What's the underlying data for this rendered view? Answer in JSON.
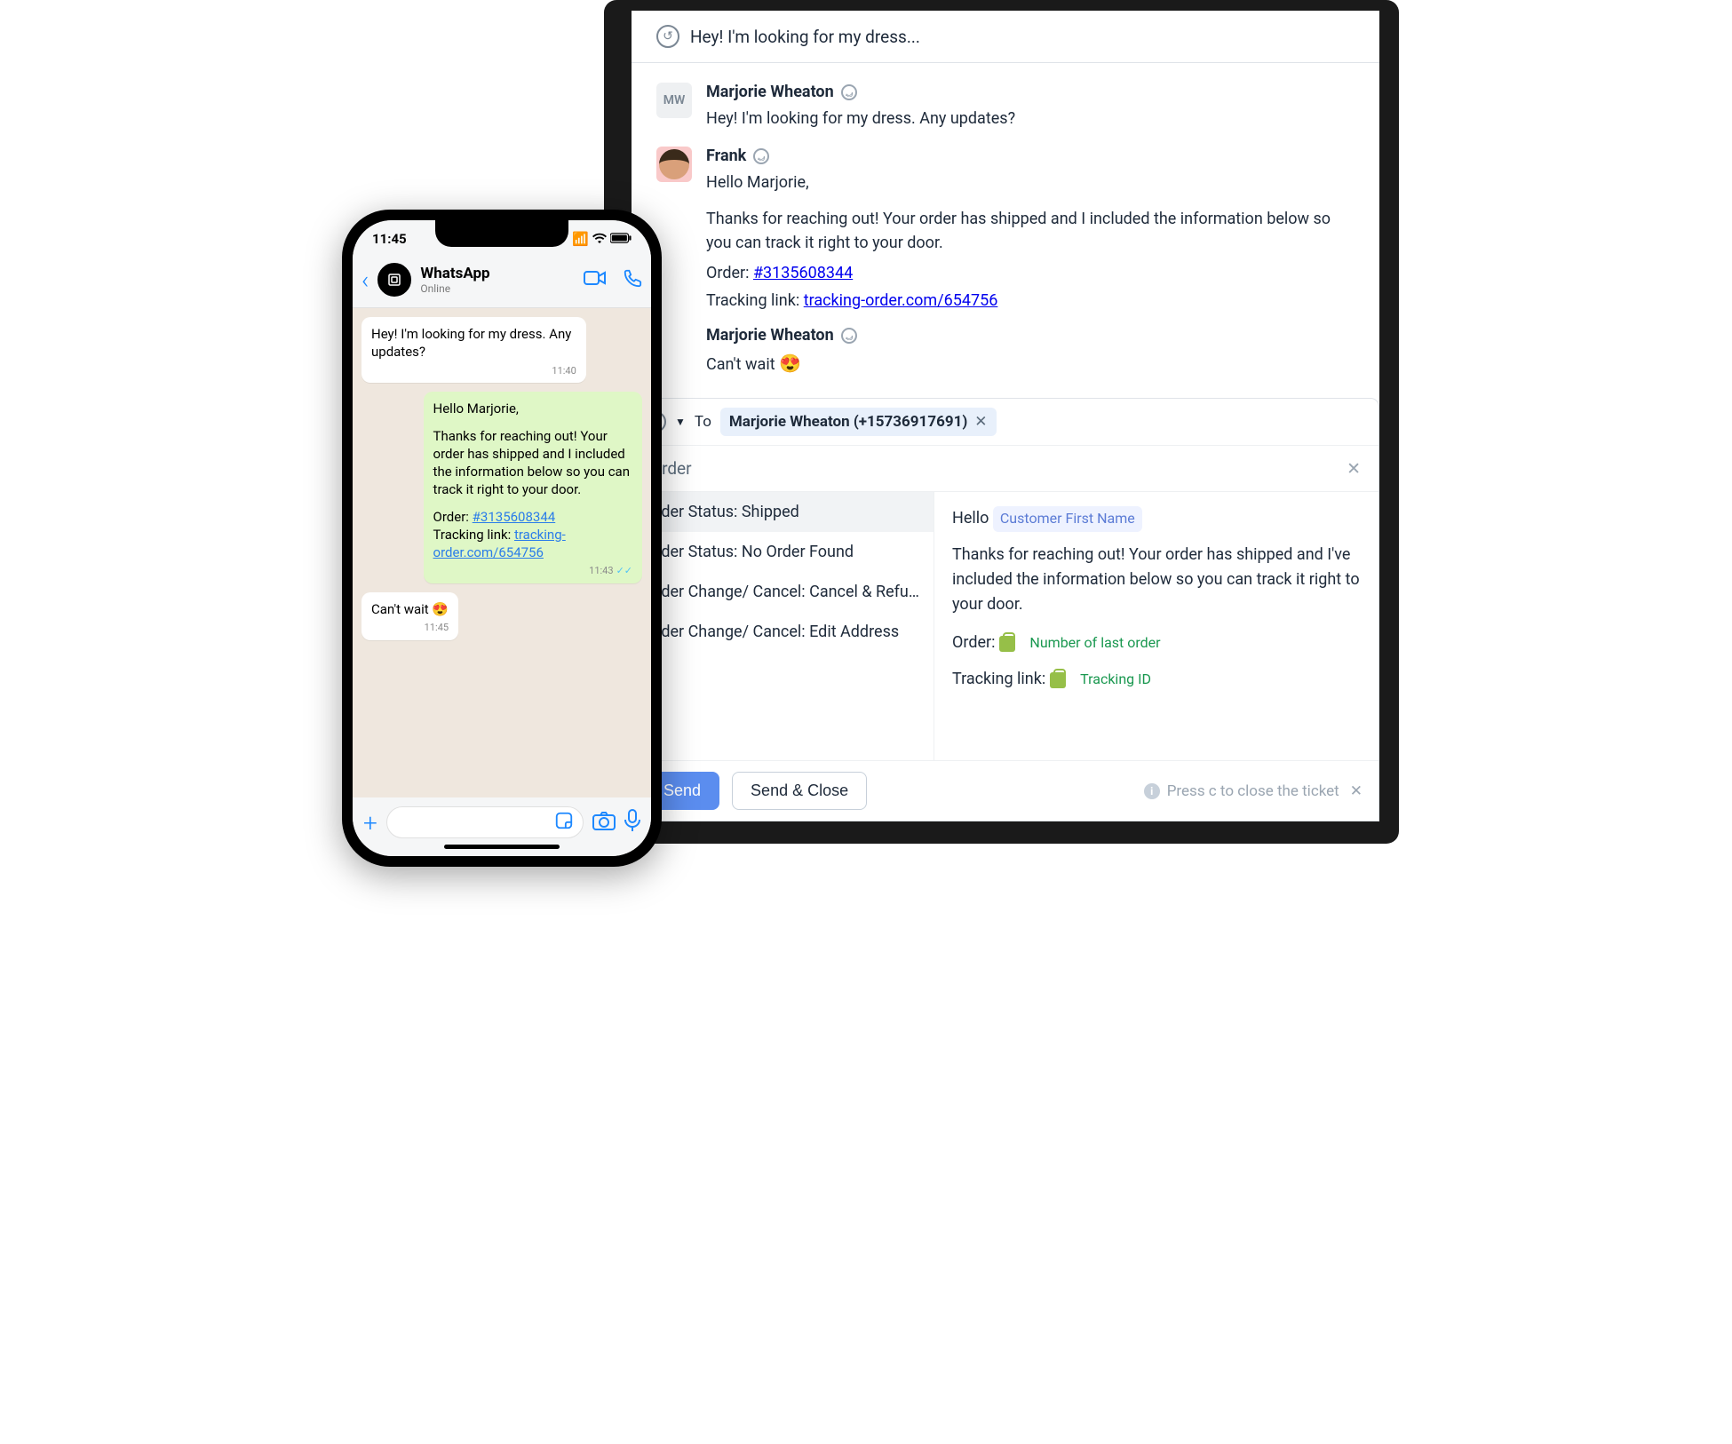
{
  "helpdesk": {
    "subject": "Hey! I'm looking for my dress...",
    "messages": {
      "m1": {
        "author": "Marjorie Wheaton",
        "initials": "MW",
        "text": "Hey! I'm looking for my dress. Any updates?"
      },
      "m2": {
        "author": "Frank",
        "greeting": "Hello Marjorie,",
        "body": "Thanks for reaching out! Your order has shipped and I included the information below so you can track it right to your door.",
        "order_label": "Order:",
        "order_value": "#3135608344",
        "tracking_label": "Tracking link:",
        "tracking_value": "tracking-order.com/654756"
      },
      "m3": {
        "author": "Marjorie Wheaton",
        "text": "Can't wait",
        "emoji": "😍"
      }
    },
    "compose": {
      "to_label": "To",
      "recipient_name": "Marjorie Wheaton (+15736917691)",
      "search_placeholder": "Order",
      "macros": [
        "Order Status: Shipped",
        "Order Status: No Order Found",
        "Order Change/ Cancel: Cancel & Refund",
        "Order Change/ Cancel: Edit Address"
      ],
      "preview": {
        "greeting": "Hello",
        "var_first": "Customer First Name",
        "body": "Thanks for reaching out! Your order has shipped and I've included the information below so you can track it right to your door.",
        "order_label": "Order:",
        "var_order": "Number of last order",
        "track_label": "Tracking link:",
        "var_track": "Tracking ID"
      }
    },
    "footer": {
      "send": "Send",
      "send_close": "Send & Close",
      "hint": "Press c to close the ticket"
    }
  },
  "phone": {
    "time": "11:45",
    "header": {
      "title": "WhatsApp",
      "subtitle": "Online"
    },
    "chat": {
      "m1": {
        "text": "Hey! I'm looking for my dress. Any updates?",
        "ts": "11:40"
      },
      "m2": {
        "greeting": "Hello Marjorie,",
        "body": "Thanks for reaching out! Your order has shipped and I included the information below so you can track it right to your door.",
        "order_label": "Order:",
        "order_value": "#3135608344",
        "track_label": "Tracking link:",
        "track_value": "tracking-order.com/654756",
        "ts": "11:43"
      },
      "m3": {
        "text": "Can't wait 😍",
        "ts": "11:45"
      }
    }
  }
}
